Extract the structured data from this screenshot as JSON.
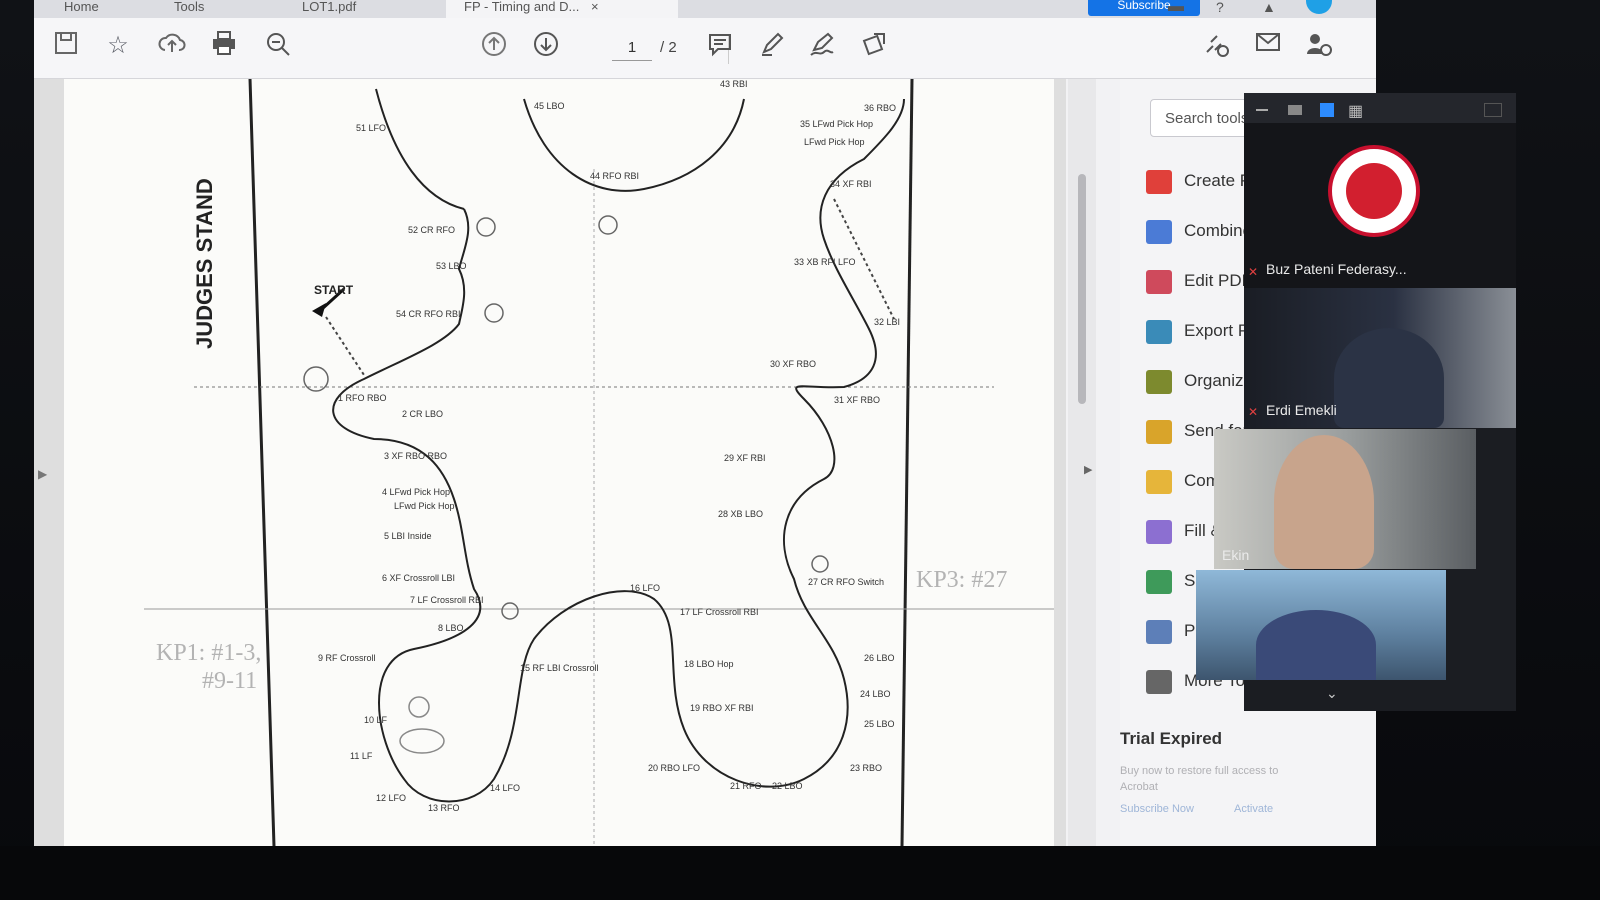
{
  "tabs": {
    "home": "Home",
    "tools": "Tools",
    "file1": "LOT1.pdf",
    "file2": "FP - Timing and D..."
  },
  "subscribe_label": "Subscribe",
  "page_nav": {
    "current": "1",
    "total": "/ 2"
  },
  "right_pane": {
    "search_placeholder": "Search tools",
    "tools": [
      {
        "label": "Create P",
        "color": "#e0403a"
      },
      {
        "label": "Combine",
        "color": "#4b7bd6"
      },
      {
        "label": "Edit PDF",
        "color": "#cf4a5c"
      },
      {
        "label": "Export P",
        "color": "#3a8bb8"
      },
      {
        "label": "Organize",
        "color": "#7d8a2e"
      },
      {
        "label": "Send for",
        "color": "#d9a42a"
      },
      {
        "label": "Commen",
        "color": "#e6b53a"
      },
      {
        "label": "Fill & Sig",
        "color": "#8c6fd1"
      },
      {
        "label": "Scan & C",
        "color": "#3e9a5a"
      },
      {
        "label": "Protect",
        "color": "#5d7fb8"
      },
      {
        "label": "More Too",
        "color": "#666666"
      }
    ],
    "trial_title": "Trial Expired",
    "trial_text": "Buy now to restore full access to Acrobat",
    "subscribe_now": "Subscribe Now",
    "activate": "Activate"
  },
  "meeting": {
    "participants": [
      {
        "name": "Buz Pateni Federasy..."
      },
      {
        "name": "Erdi Emekli"
      },
      {
        "name": "Ekin"
      },
      {
        "name": ""
      }
    ]
  },
  "diagram": {
    "side_label": "JUDGES STAND",
    "start_label": "START",
    "kp1_line1": "KP1: #1-3,",
    "kp1_line2": "#9-11",
    "kp3": "KP3: #27",
    "step_labels": [
      "1 RFO RBO",
      "2 CR LBO",
      "3 XF RBO RBO",
      "4 LFwd Pick Hop",
      "LFwd Pick Hop",
      "5 LBI Inside",
      "6 XF Crossroll LBI",
      "7 LF Crossroll RBI",
      "8 LBO",
      "9 RF Crossroll",
      "10 LF",
      "11 LF",
      "12 LFO",
      "13 RFO",
      "14 LFO",
      "15 RF LBI Crossroll",
      "16 LFO",
      "17 LF Crossroll RBI",
      "18 LBO Hop",
      "19 RBO XF RBI",
      "20 RBO LFO",
      "21 RFO",
      "22 LBO",
      "23 RBO",
      "24 LBO",
      "25 LBO",
      "26 LBO",
      "27 CR RFO Switch",
      "28 XB LBO",
      "29 XF RBI",
      "30 XF RBO",
      "31 XF RBO",
      "32 LBI",
      "33 XB RFI LFO",
      "34 XF RBI",
      "35 LFwd Pick Hop",
      "LFwd Pick Hop",
      "36 RBO",
      "43 RBI",
      "44 RFO RBI",
      "45 LBO",
      "51 LFO",
      "52 CR RFO",
      "53 LBO",
      "54 CR RFO RBI"
    ]
  }
}
